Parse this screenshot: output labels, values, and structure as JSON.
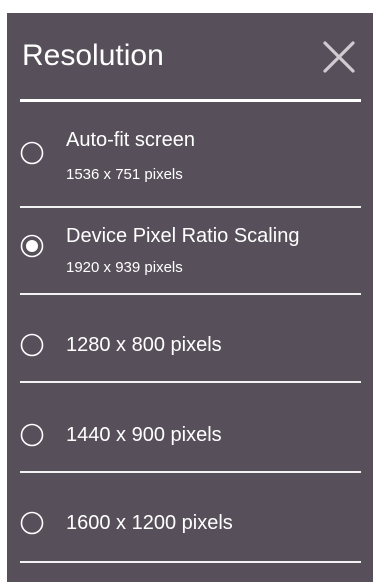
{
  "dialog": {
    "title": "Resolution",
    "close_icon": "close-icon",
    "colors": {
      "background": "#57505a",
      "text": "#ffffff",
      "divider": "#f2f2f2"
    }
  },
  "options": [
    {
      "label": "Auto-fit screen",
      "sublabel": "1536 x 751 pixels",
      "selected": false
    },
    {
      "label": "Device Pixel Ratio Scaling",
      "sublabel": "1920 x 939 pixels",
      "selected": true
    },
    {
      "label": "1280 x 800 pixels",
      "selected": false
    },
    {
      "label": "1440 x 900 pixels",
      "selected": false
    },
    {
      "label": "1600 x 1200 pixels",
      "selected": false
    }
  ]
}
